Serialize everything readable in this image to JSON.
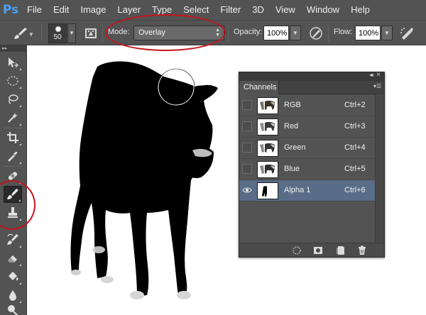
{
  "app": {
    "logo": "Ps"
  },
  "menu": [
    "File",
    "Edit",
    "Image",
    "Layer",
    "Type",
    "Select",
    "Filter",
    "3D",
    "View",
    "Window",
    "Help"
  ],
  "options": {
    "brush_size": "50",
    "mode_label": "Mode:",
    "mode_value": "Overlay",
    "opacity_label": "Opacity:",
    "opacity_value": "100%",
    "flow_label": "Flow:",
    "flow_value": "100%"
  },
  "tools": [
    {
      "icon": "move-tool-icon",
      "active": false
    },
    {
      "icon": "elliptical-marquee-icon",
      "active": false
    },
    {
      "icon": "lasso-icon",
      "active": false
    },
    {
      "icon": "magic-wand-icon",
      "active": false
    },
    {
      "icon": "crop-icon",
      "active": false
    },
    {
      "icon": "eyedropper-icon",
      "active": false
    },
    {
      "icon": "healing-brush-icon",
      "active": false
    },
    {
      "icon": "brush-tool-icon",
      "active": true
    },
    {
      "icon": "clone-stamp-icon",
      "active": false
    },
    {
      "icon": "history-brush-icon",
      "active": false
    },
    {
      "icon": "eraser-icon",
      "active": false
    },
    {
      "icon": "paint-bucket-icon",
      "active": false
    },
    {
      "icon": "blur-tool-icon",
      "active": false
    },
    {
      "icon": "dodge-tool-icon",
      "active": false
    }
  ],
  "channels_panel": {
    "tab": "Channels",
    "channels": [
      {
        "name": "RGB",
        "shortcut": "Ctrl+2",
        "visible": false,
        "selected": false
      },
      {
        "name": "Red",
        "shortcut": "Ctrl+3",
        "visible": false,
        "selected": false
      },
      {
        "name": "Green",
        "shortcut": "Ctrl+4",
        "visible": false,
        "selected": false
      },
      {
        "name": "Blue",
        "shortcut": "Ctrl+5",
        "visible": false,
        "selected": false
      },
      {
        "name": "Alpha 1",
        "shortcut": "Ctrl+6",
        "visible": true,
        "selected": true
      }
    ]
  },
  "colors": {
    "annotation": "#c4161c",
    "selected_row": "#596c88",
    "ui_gray": "#535353"
  }
}
